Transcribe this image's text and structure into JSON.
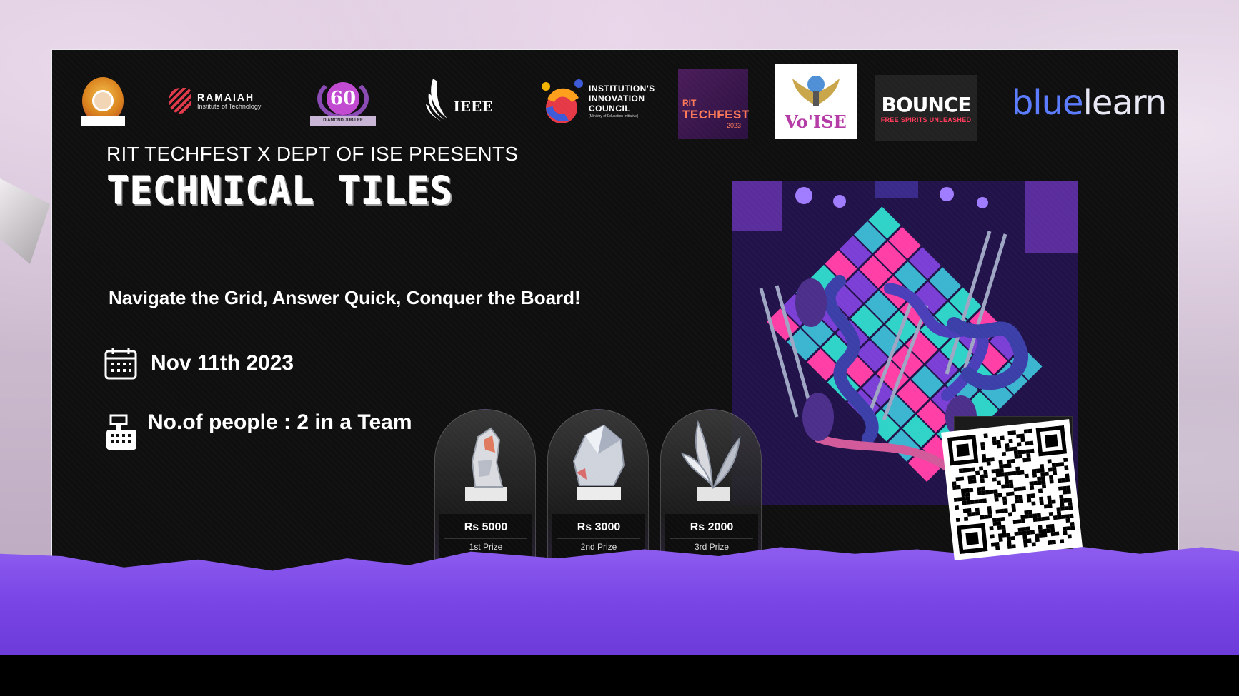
{
  "presents_text": "RIT TECHFEST X DEPT OF ISE PRESENTS",
  "event_title": "TECHNICAL TILES",
  "tagline": "Navigate the Grid, Answer Quick, Conquer the Board!",
  "date": "Nov 11th 2023",
  "team_info": "No.of people : 2 in a Team",
  "logos": {
    "ramaiah_name": "RAMAIAH",
    "ramaiah_sub": "Institute of Technology",
    "jubilee_number": "60",
    "jubilee_banner": "DIAMOND JUBILEE",
    "ieee": "IEEE",
    "iic_line1": "INSTITUTION'S",
    "iic_line2": "INNOVATION",
    "iic_line3": "COUNCIL",
    "iic_sub": "(Ministry of Education Initiative)",
    "rit_line1": "RIT",
    "rit_line2": "TECHFEST",
    "rit_year": "2023",
    "voise": "Vo'ISE",
    "bounce_name": "BOUNCE",
    "bounce_tagline": "FREE SPIRITS UNLEASHED",
    "bluelearn_part1": "blue",
    "bluelearn_part2": "learn"
  },
  "prizes": [
    {
      "amount": "Rs 5000",
      "rank": "1st Prize"
    },
    {
      "amount": "Rs 3000",
      "rank": "2nd Prize"
    },
    {
      "amount": "Rs 2000",
      "rank": "3rd Prize"
    }
  ],
  "icons": {
    "date": "calendar-icon",
    "team": "cash-register-icon",
    "qr": "qr-code"
  },
  "colors": {
    "panel": "#0f0f10",
    "wave": "#7a46e6",
    "board_teal": "#2fd3c8",
    "board_pink": "#ff3fa6",
    "board_purple": "#7b3fd6"
  }
}
